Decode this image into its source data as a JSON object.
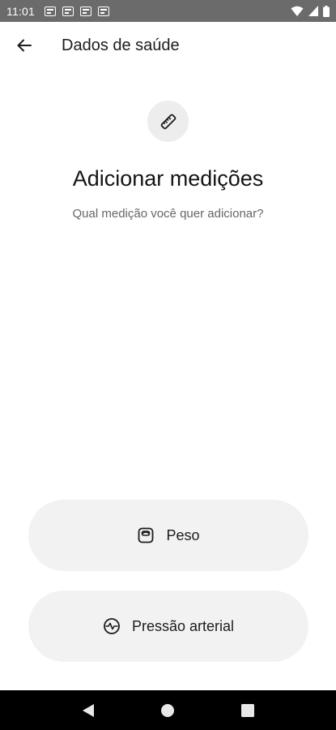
{
  "status_bar": {
    "time": "11:01",
    "notification_icons": [
      "notification-icon",
      "notification-icon",
      "notification-icon",
      "notification-icon"
    ],
    "system_icons": [
      "wifi-icon",
      "cellular-icon",
      "battery-icon"
    ]
  },
  "app_bar": {
    "back_icon": "arrow-back-icon",
    "title": "Dados de saúde"
  },
  "hero": {
    "icon": "ruler-icon",
    "title": "Adicionar medições",
    "subtitle": "Qual medição você quer adicionar?"
  },
  "options": [
    {
      "icon": "scale-icon",
      "label": "Peso"
    },
    {
      "icon": "heart-pulse-icon",
      "label": "Pressão arterial"
    }
  ],
  "nav_bar": {
    "buttons": [
      "back-triangle-icon",
      "home-circle-icon",
      "recents-square-icon"
    ]
  },
  "colors": {
    "status_bar": "#6b6b6b",
    "button_bg": "#f2f2f2",
    "icon_circle_bg": "#ededed",
    "nav_bar": "#000000"
  }
}
